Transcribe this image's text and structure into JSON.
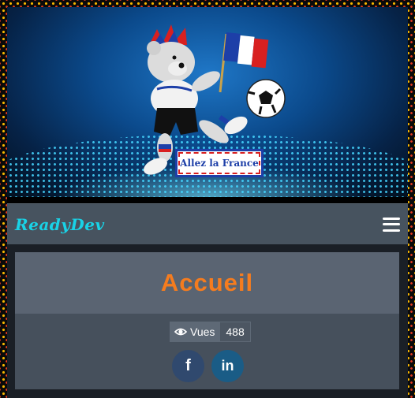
{
  "banner": {
    "sign_text": "Allez la France"
  },
  "navbar": {
    "brand": "ReadyDev"
  },
  "page": {
    "title": "Accueil"
  },
  "stats": {
    "views_label": "Vues",
    "views_count": "488"
  },
  "social": {
    "facebook_glyph": "f",
    "linkedin_glyph": "in"
  },
  "colors": {
    "title": "#f57c1f",
    "brand": "#19d2e6",
    "navbar": "#47535f",
    "frame_dots": "#f7b500"
  },
  "icons": [
    "eye-icon",
    "facebook-icon",
    "linkedin-icon",
    "menu-icon"
  ]
}
